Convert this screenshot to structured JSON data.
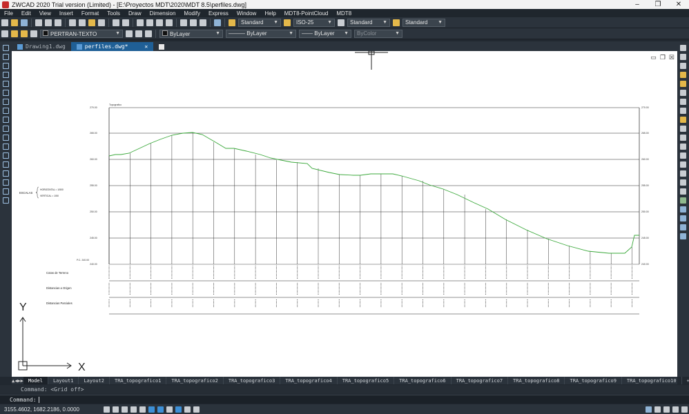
{
  "window": {
    "title": "ZWCAD 2020 Trial version (Limited) - [E:\\Proyectos MDT\\2020\\MDT 8.5\\perfiles.dwg]",
    "minimize": "–",
    "restore": "❐",
    "close": "✕"
  },
  "menu": [
    "File",
    "Edit",
    "View",
    "Insert",
    "Format",
    "Tools",
    "Draw",
    "Dimension",
    "Modify",
    "Express",
    "Window",
    "Help",
    "MDT8-PointCloud",
    "MDT8"
  ],
  "toolbar1": {
    "text_style": "Standard",
    "dim_style": "ISO-25",
    "table_style": "Standard",
    "multileader_style": "Standard"
  },
  "toolbar2": {
    "layer": "PERTRAN-TEXTO",
    "color": "ByLayer",
    "linetype": "ByLayer",
    "lineweight": "ByLayer",
    "plotstyle": "ByColor"
  },
  "doc_tabs": [
    {
      "label": "Drawing1.dwg",
      "active": false
    },
    {
      "label": "perfiles.dwg*",
      "active": true
    }
  ],
  "tab_close": "✕",
  "drawing": {
    "header": "Topografico",
    "scales_label": "ESCALAS",
    "scale_h": "HORIZONTAL = 1/500",
    "scale_v": "VERTICAL    = 1/50",
    "datum": "P.C. 240.00",
    "row_labels": [
      "Cotas de Terreno",
      "Distancias a Origen",
      "Distancias Parciales"
    ],
    "elev_labels": [
      "270.00",
      "265.00",
      "260.00",
      "255.00",
      "250.00",
      "245.00",
      "240.00"
    ],
    "ucs_y": "Y",
    "ucs_x": "X"
  },
  "layout_tabs": [
    "Model",
    "Layout1",
    "Layout2",
    "TRA_topografico1",
    "TRA_topografico2",
    "TRA_topografico3",
    "TRA_topografico4",
    "TRA_topografico5",
    "TRA_topografico6",
    "TRA_topografico7",
    "TRA_topografico8",
    "TRA_topografico9",
    "TRA_topografico10",
    "+"
  ],
  "command": {
    "history": "Command:  <Grid off>",
    "prompt": "Command:"
  },
  "status": {
    "coordinates": "3155.4602, 1682.2186, 0.0000"
  },
  "colors": {
    "profile": "#3aa83a",
    "accent": "#1f5f96",
    "background": "#212830"
  }
}
